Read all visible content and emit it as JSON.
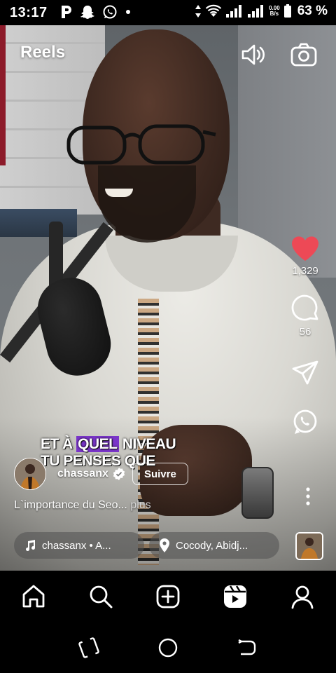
{
  "status_bar": {
    "time": "13:17",
    "notification_icons": [
      "p-icon",
      "snapchat-icon",
      "whatsapp-icon",
      "dot-icon"
    ],
    "net_speed_value": "0.00",
    "net_speed_unit": "B/s",
    "battery": "63 %"
  },
  "header": {
    "title": "Reels",
    "sound_icon": "volume-icon",
    "camera_icon": "camera-icon"
  },
  "video": {
    "caption_line1_pre": "ET À ",
    "caption_line1_hl": "QUEL",
    "caption_line1_post": " NIVEAU",
    "caption_line2": "TU PENSES QUE"
  },
  "actions": {
    "likes": "1,329",
    "comments": "56",
    "like_color": "#ed4956"
  },
  "post": {
    "username": "chassanx",
    "follow_label": "Suivre",
    "description": "L`importance du Seo...",
    "more_label": "plus",
    "music": "chassanx • A...",
    "location": "Cocody, Abidj..."
  },
  "nav": [
    "home-icon",
    "search-icon",
    "create-icon",
    "reels-icon",
    "profile-icon"
  ],
  "system_nav": [
    "recents-icon",
    "home-circle-icon",
    "back-icon"
  ]
}
